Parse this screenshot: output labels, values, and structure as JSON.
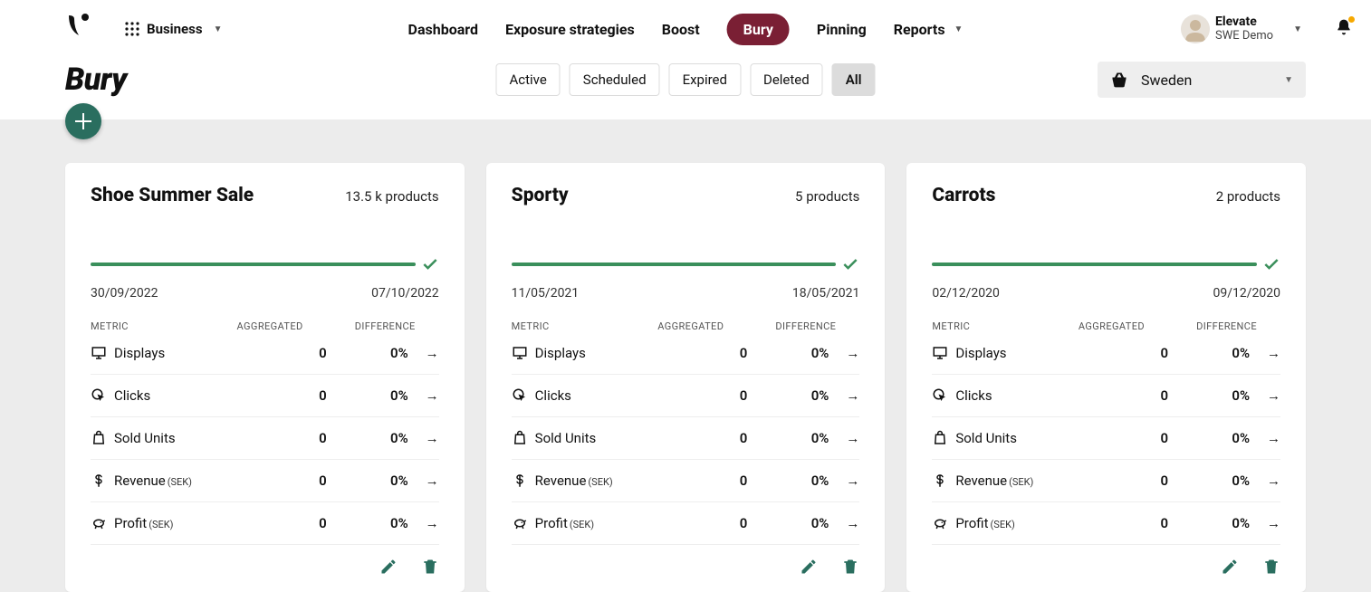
{
  "header": {
    "workspace_label": "Business",
    "nav": {
      "dashboard": "Dashboard",
      "exposure": "Exposure strategies",
      "boost": "Boost",
      "bury": "Bury",
      "pinning": "Pinning",
      "reports": "Reports"
    },
    "user": {
      "name": "Elevate",
      "sub": "SWE Demo"
    }
  },
  "page": {
    "title": "Bury",
    "filters": {
      "active": "Active",
      "scheduled": "Scheduled",
      "expired": "Expired",
      "deleted": "Deleted",
      "all": "All"
    },
    "locale": "Sweden"
  },
  "meta": {
    "table_header": {
      "metric": "METRIC",
      "aggregated": "AGGREGATED",
      "difference": "DIFFERENCE"
    },
    "metric_labels": {
      "displays": "Displays",
      "clicks": "Clicks",
      "sold": "Sold Units",
      "revenue": "Revenue",
      "profit": "Profit"
    },
    "currency_unit": "(SEK)"
  },
  "cards": [
    {
      "title": "Shoe Summer Sale",
      "count_label": "13.5 k products",
      "date_start": "30/09/2022",
      "date_end": "07/10/2022",
      "metrics": {
        "displays": {
          "agg": "0",
          "diff": "0%"
        },
        "clicks": {
          "agg": "0",
          "diff": "0%"
        },
        "sold": {
          "agg": "0",
          "diff": "0%"
        },
        "revenue": {
          "agg": "0",
          "diff": "0%"
        },
        "profit": {
          "agg": "0",
          "diff": "0%"
        }
      }
    },
    {
      "title": "Sporty",
      "count_label": "5 products",
      "date_start": "11/05/2021",
      "date_end": "18/05/2021",
      "metrics": {
        "displays": {
          "agg": "0",
          "diff": "0%"
        },
        "clicks": {
          "agg": "0",
          "diff": "0%"
        },
        "sold": {
          "agg": "0",
          "diff": "0%"
        },
        "revenue": {
          "agg": "0",
          "diff": "0%"
        },
        "profit": {
          "agg": "0",
          "diff": "0%"
        }
      }
    },
    {
      "title": "Carrots",
      "count_label": "2 products",
      "date_start": "02/12/2020",
      "date_end": "09/12/2020",
      "metrics": {
        "displays": {
          "agg": "0",
          "diff": "0%"
        },
        "clicks": {
          "agg": "0",
          "diff": "0%"
        },
        "sold": {
          "agg": "0",
          "diff": "0%"
        },
        "revenue": {
          "agg": "0",
          "diff": "0%"
        },
        "profit": {
          "agg": "0",
          "diff": "0%"
        }
      }
    }
  ]
}
